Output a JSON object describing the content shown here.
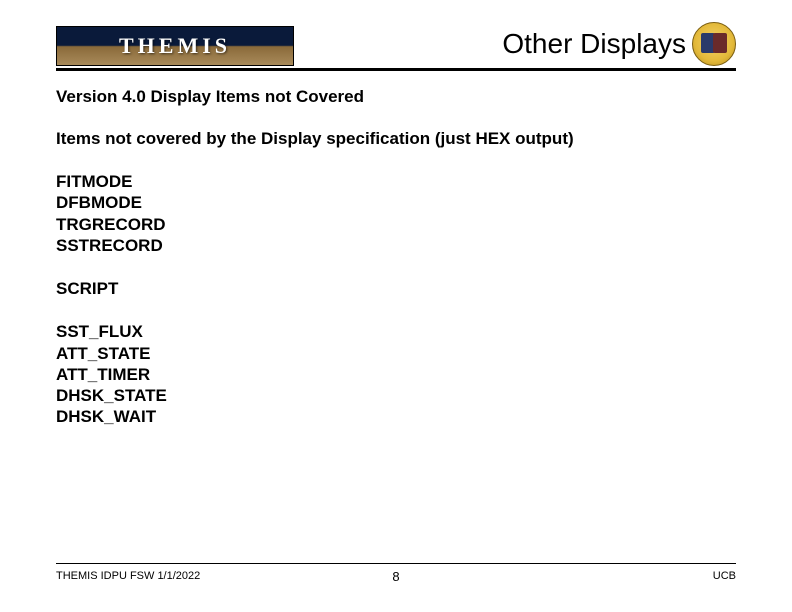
{
  "header": {
    "logo_text": "THEMIS",
    "slide_title": "Other Displays",
    "badge_name": "themis-mission-badge"
  },
  "content": {
    "heading1": "Version 4.0 Display Items not Covered",
    "heading2": "Items not covered by the Display specification (just HEX output)",
    "group1": {
      "i0": "FITMODE",
      "i1": "DFBMODE",
      "i2": "TRGRECORD",
      "i3": "SSTRECORD"
    },
    "group2": {
      "i0": "SCRIPT"
    },
    "group3": {
      "i0": "SST_FLUX",
      "i1": "ATT_STATE",
      "i2": "ATT_TIMER",
      "i3": "DHSK_STATE",
      "i4": "DHSK_WAIT"
    }
  },
  "footer": {
    "left": "THEMIS IDPU FSW 1/1/2022",
    "center": "8",
    "right": "UCB"
  }
}
